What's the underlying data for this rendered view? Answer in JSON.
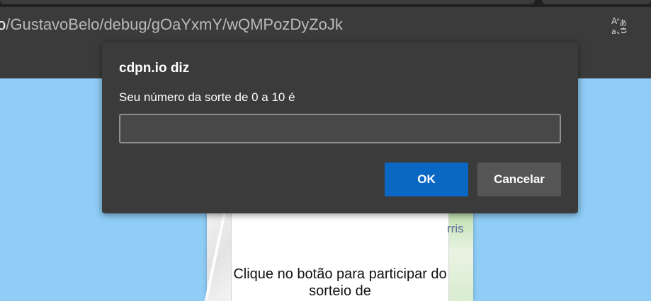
{
  "browser": {
    "url_host_fragment": "o",
    "url_path": "/GustavoBelo/debug/gOaYxmY/wQMPozDyZoJk",
    "translate_icon": "translate-icon"
  },
  "dialog": {
    "title": "cdpn.io diz",
    "message": "Seu número da sorte de 0 a 10 é",
    "input_value": "",
    "ok_label": "OK",
    "cancel_label": "Cancelar",
    "ok_color": "#0a67c3",
    "background_color": "#3b3b3b"
  },
  "page": {
    "background_color": "#8fcdf7",
    "map_label_fragment": "rris",
    "card_text": "Clique no botão para participar do sorteio de"
  }
}
